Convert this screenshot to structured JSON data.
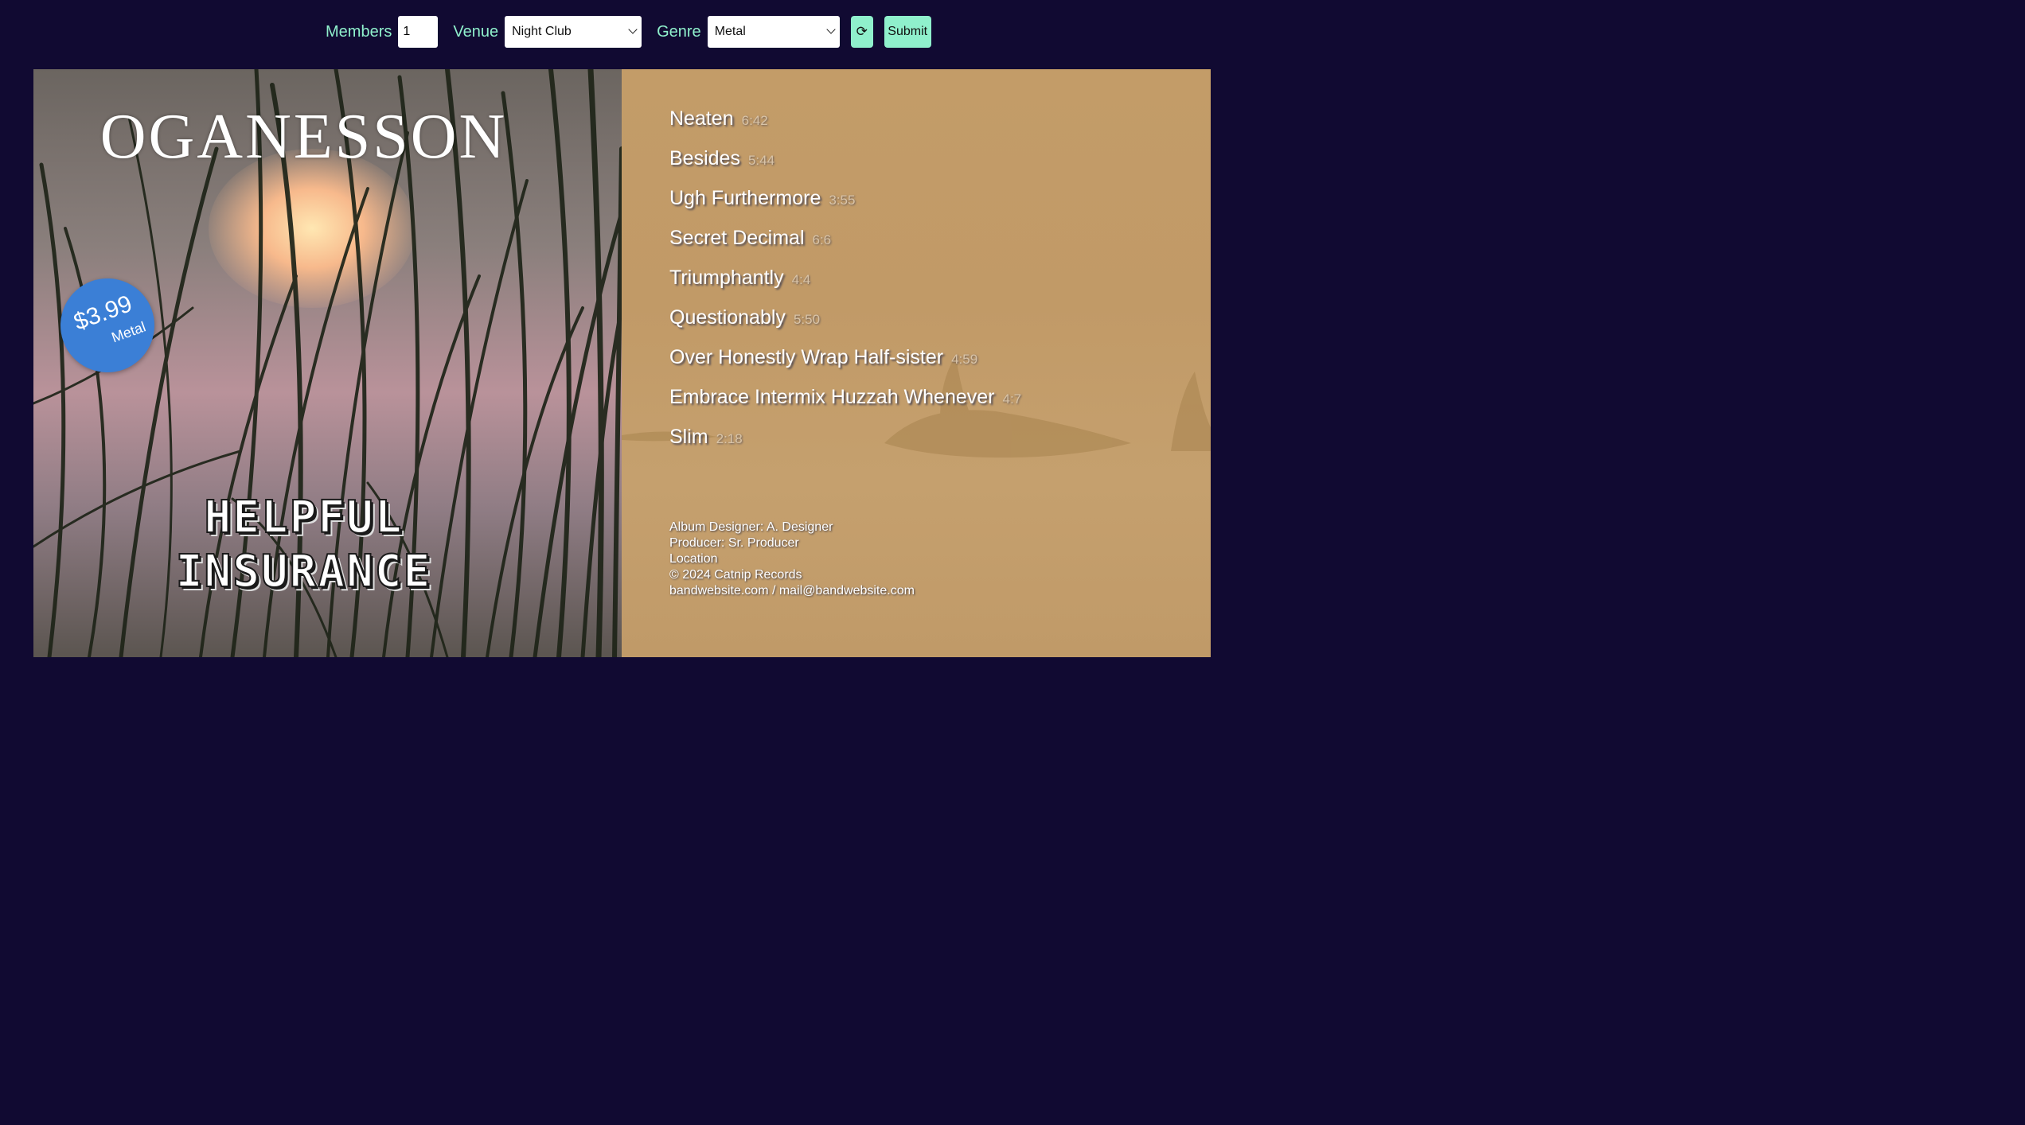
{
  "form": {
    "members_label": "Members",
    "members_value": "1",
    "venue_label": "Venue",
    "venue_selected": "Night Club",
    "genre_label": "Genre",
    "genre_selected": "Metal",
    "refresh_glyph": "⟳",
    "submit_label": "Submit"
  },
  "album": {
    "band_name": "OGANESSON",
    "title_line1": "HELPFUL",
    "title_line2": "INSURANCE",
    "price": "$3.99",
    "genre_badge": "Metal"
  },
  "tracks": [
    {
      "title": "Neaten",
      "time": "6:42"
    },
    {
      "title": "Besides",
      "time": "5:44"
    },
    {
      "title": "Ugh Furthermore",
      "time": "3:55"
    },
    {
      "title": "Secret Decimal",
      "time": "6:6"
    },
    {
      "title": "Triumphantly",
      "time": "4:4"
    },
    {
      "title": "Questionably",
      "time": "5:50"
    },
    {
      "title": "Over Honestly Wrap Half-sister",
      "time": "4:59"
    },
    {
      "title": "Embrace Intermix Huzzah Whenever",
      "time": "4:7"
    },
    {
      "title": "Slim",
      "time": "2:18"
    }
  ],
  "credits": {
    "designer": "Album Designer: A. Designer",
    "producer": "Producer: Sr. Producer",
    "location": "Location",
    "copyright": "© 2024 Catnip Records",
    "web": "bandwebsite.com / mail@bandwebsite.com"
  },
  "colors": {
    "background": "#110a32",
    "accent": "#8ff0cc",
    "badge": "#3b7fd6",
    "back_cover": "#c39c68"
  }
}
